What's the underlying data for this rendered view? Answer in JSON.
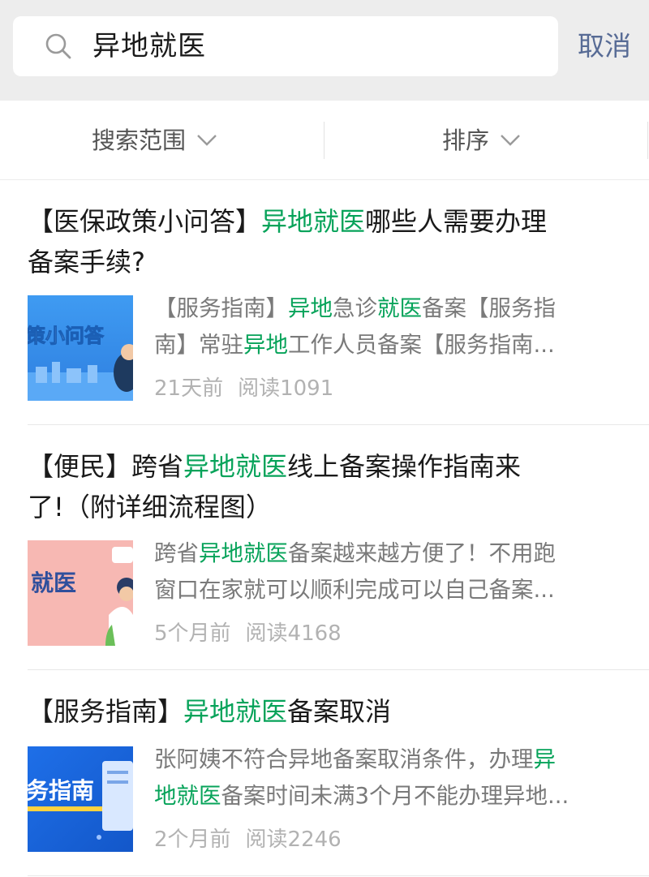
{
  "search": {
    "query": "异地就医",
    "cancel_label": "取消"
  },
  "filters": {
    "scope_label": "搜索范围",
    "sort_label": "排序"
  },
  "results": [
    {
      "title_parts": [
        {
          "text": "【医保政策小问答】",
          "hl": false
        },
        {
          "text": "异地就医",
          "hl": true
        },
        {
          "text": "哪些人需要办理",
          "hl": false
        }
      ],
      "title_parts_2": [
        {
          "text": "备案手续?",
          "hl": false
        }
      ],
      "thumb_text": "策小问答",
      "snippet_line1": [
        {
          "text": "【服务指南】",
          "hl": false
        },
        {
          "text": "异地",
          "hl": true
        },
        {
          "text": "急诊",
          "hl": false
        },
        {
          "text": "就医",
          "hl": true
        },
        {
          "text": "备案【服务指",
          "hl": false
        }
      ],
      "snippet_line2": [
        {
          "text": "南】常驻",
          "hl": false
        },
        {
          "text": "异地",
          "hl": true
        },
        {
          "text": "工作人员备案【服务指南...",
          "hl": false
        }
      ],
      "time": "21天前",
      "reads": "阅读1091"
    },
    {
      "title_parts": [
        {
          "text": "【便民】跨省",
          "hl": false
        },
        {
          "text": "异地就医",
          "hl": true
        },
        {
          "text": "线上备案操作指南来",
          "hl": false
        }
      ],
      "title_parts_2": [
        {
          "text": "了!（附详细流程图）",
          "hl": false
        }
      ],
      "thumb_text": "就医",
      "snippet_line1": [
        {
          "text": "跨省",
          "hl": false
        },
        {
          "text": "异地就医",
          "hl": true
        },
        {
          "text": "备案越来越方便了！不用跑",
          "hl": false
        }
      ],
      "snippet_line2": [
        {
          "text": "窗口在家就可以顺利完成可以自己备案...",
          "hl": false
        }
      ],
      "time": "5个月前",
      "reads": "阅读4168"
    },
    {
      "title_parts": [
        {
          "text": "【服务指南】",
          "hl": false
        },
        {
          "text": "异地就医",
          "hl": true
        },
        {
          "text": "备案取消",
          "hl": false
        }
      ],
      "title_parts_2": [],
      "thumb_text": "务指南",
      "snippet_line1": [
        {
          "text": "张阿姨不符合异地备案取消条件，办理",
          "hl": false
        },
        {
          "text": "异",
          "hl": true
        }
      ],
      "snippet_line2": [
        {
          "text": "地就医",
          "hl": true
        },
        {
          "text": "备案时间未满3个月不能办理异地...",
          "hl": false
        }
      ],
      "time": "2个月前",
      "reads": "阅读2246"
    }
  ]
}
